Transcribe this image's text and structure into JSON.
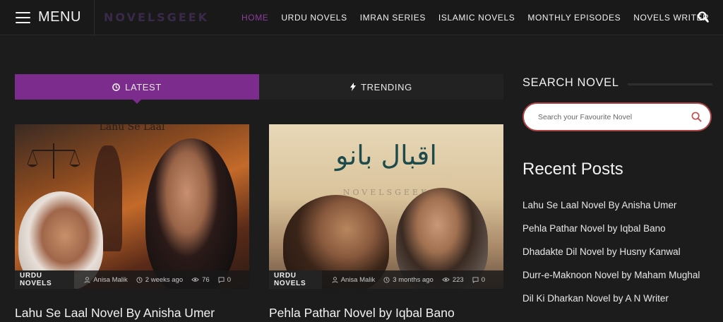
{
  "header": {
    "menu_label": "MENU",
    "logo_text": "NOVELSGEEK",
    "nav": [
      {
        "label": "HOME",
        "active": true
      },
      {
        "label": "URDU NOVELS",
        "active": false
      },
      {
        "label": "IMRAN SERIES",
        "active": false
      },
      {
        "label": "ISLAMIC NOVELS",
        "active": false
      },
      {
        "label": "MONTHLY EPISODES",
        "active": false
      },
      {
        "label": "NOVELS WRITER",
        "active": false
      }
    ],
    "search_icon": "search-icon"
  },
  "tabs": [
    {
      "label": "LATEST",
      "icon": "clock-icon",
      "active": true
    },
    {
      "label": "TRENDING",
      "icon": "bolt-icon",
      "active": false
    }
  ],
  "posts": [
    {
      "cover_text": "Lahu Se Laal",
      "category": "URDU NOVELS",
      "author": "Anisa Malik",
      "time": "2 weeks ago",
      "views": "76",
      "comments": "0",
      "title": "Lahu Se Laal Novel By Anisha Umer"
    },
    {
      "cover_text": "اقبال بانو",
      "watermark": "NOVELSGEEK",
      "category": "URDU NOVELS",
      "author": "Anisa Malik",
      "time": "3 months ago",
      "views": "223",
      "comments": "0",
      "title": "Pehla Pathar Novel by Iqbal Bano"
    }
  ],
  "sidebar": {
    "search_title": "SEARCH NOVEL",
    "search_placeholder": "Search your Favourite Novel",
    "recent_title": "Recent Posts",
    "recent_posts": [
      "Lahu Se Laal Novel By Anisha Umer",
      "Pehla Pathar Novel by Iqbal Bano",
      "Dhadakte Dil Novel by Husny Kanwal",
      "Durr-e-Maknoon Novel by Maham Mughal",
      "Dil Ki Dharkan Novel by A N Writer"
    ]
  },
  "colors": {
    "accent": "#7b2c8c",
    "background": "#1c1c1d",
    "search_border": "#aa4444"
  }
}
